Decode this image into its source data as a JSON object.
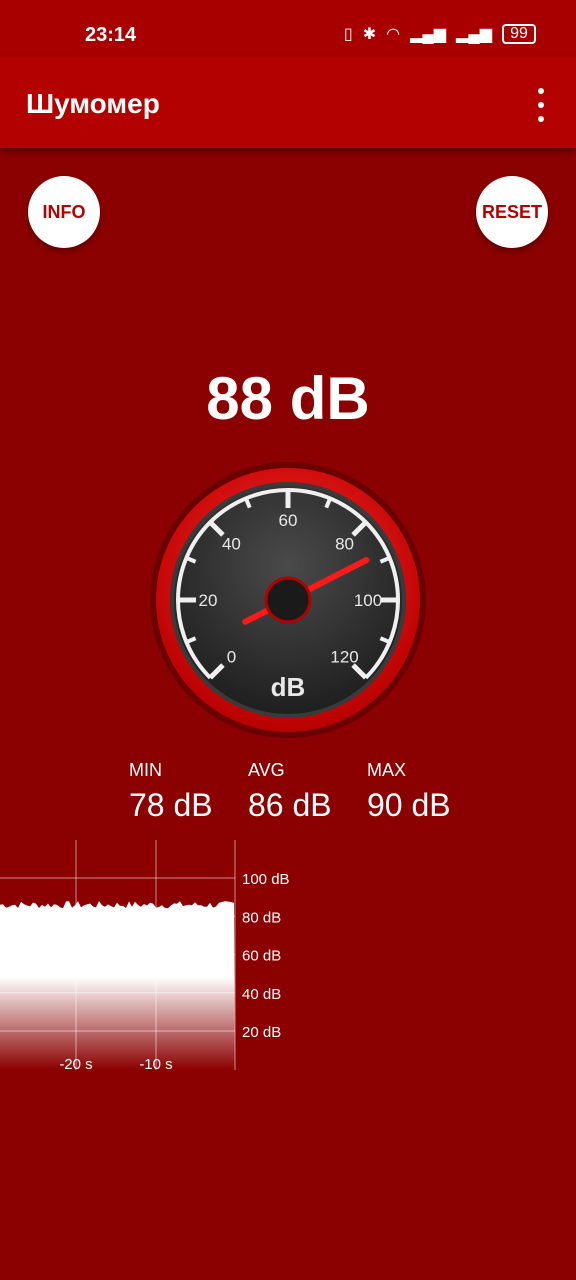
{
  "status": {
    "time": "23:14",
    "battery": "99"
  },
  "app": {
    "title": "Шумомер"
  },
  "buttons": {
    "info": "INFO",
    "reset": "RESET"
  },
  "reading": {
    "current": "88 dB",
    "value": 88
  },
  "gauge": {
    "unit": "dB",
    "ticks": [
      "0",
      "20",
      "40",
      "60",
      "80",
      "100",
      "120"
    ],
    "min": 0,
    "max": 120
  },
  "stats": {
    "min_label": "MIN",
    "min_value": "78 dB",
    "avg_label": "AVG",
    "avg_value": "86 dB",
    "max_label": "MAX",
    "max_value": "90 dB"
  },
  "history": {
    "y_labels": [
      "100 dB",
      "80 dB",
      "60 dB",
      "40 dB",
      "20 dB"
    ],
    "x_labels": [
      "-20 s",
      "-10 s"
    ]
  },
  "colors": {
    "background": "#8b0000",
    "appbar": "#b30000",
    "accent": "#e00000"
  }
}
